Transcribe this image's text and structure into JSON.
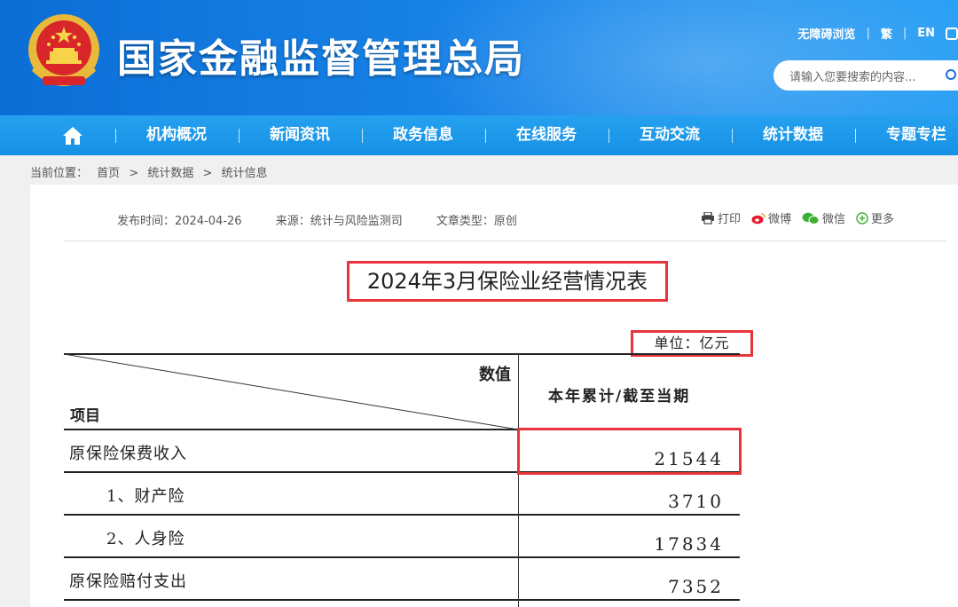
{
  "site": {
    "title": "国家金融监督管理总局",
    "top_links": [
      "无障碍浏览",
      "繁",
      "EN"
    ],
    "search_placeholder": "请输入您要搜索的内容..."
  },
  "nav": {
    "items": [
      "机构概况",
      "新闻资讯",
      "政务信息",
      "在线服务",
      "互动交流",
      "统计数据",
      "专题专栏"
    ]
  },
  "breadcrumb": {
    "label": "当前位置：",
    "path": [
      "首页",
      "统计数据",
      "统计信息"
    ],
    "sep": ">"
  },
  "meta": {
    "publish": "发布时间：2024-04-26",
    "source": "来源：统计与风险监测司",
    "type": "文章类型：原创"
  },
  "share": {
    "print": "打印",
    "weibo": "微博",
    "wechat": "微信",
    "more": "更多"
  },
  "document": {
    "title": "2024年3月保险业经营情况表",
    "unit": "单位：亿元"
  },
  "table": {
    "header_value": "数值",
    "header_item": "项目",
    "header_col": "本年累计/截至当期",
    "rows": [
      {
        "label": "原保险保费收入",
        "value": "21544",
        "indent": false
      },
      {
        "label": "1、财产险",
        "value": "3710",
        "indent": true
      },
      {
        "label": "2、人身险",
        "value": "17834",
        "indent": true
      },
      {
        "label": "原保险赔付支出",
        "value": "7352",
        "indent": false
      }
    ]
  },
  "colors": {
    "header_blue": "#0b6ed6",
    "nav_blue": "#1690e4",
    "highlight_red": "#e8343a"
  }
}
